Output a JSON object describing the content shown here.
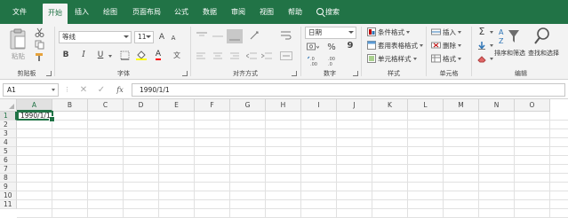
{
  "ribbon": {
    "tabs": [
      {
        "label": "文件",
        "active": false
      },
      {
        "label": "开始",
        "active": true
      },
      {
        "label": "插入",
        "active": false
      },
      {
        "label": "绘图",
        "active": false
      },
      {
        "label": "页面布局",
        "active": false
      },
      {
        "label": "公式",
        "active": false
      },
      {
        "label": "数据",
        "active": false
      },
      {
        "label": "审阅",
        "active": false
      },
      {
        "label": "视图",
        "active": false
      },
      {
        "label": "帮助",
        "active": false
      }
    ],
    "search_label": "搜索",
    "clipboard": {
      "group_label": "剪贴板",
      "paste_label": "粘贴"
    },
    "font": {
      "group_label": "字体",
      "font_name": "等线",
      "font_size": "11",
      "bold": "B",
      "italic": "I",
      "underline": "U",
      "grow": "A",
      "shrink": "A",
      "color_letter": "A",
      "wen": "文"
    },
    "alignment": {
      "group_label": "对齐方式"
    },
    "number": {
      "group_label": "数字",
      "format": "日期",
      "percent": "%",
      "comma": "9"
    },
    "styles": {
      "group_label": "样式",
      "conditional": "条件格式",
      "table_format": "套用表格格式",
      "cell_styles": "单元格样式"
    },
    "cells": {
      "group_label": "单元格",
      "insert": "插入",
      "delete": "删除",
      "format": "格式"
    },
    "editing": {
      "group_label": "编辑",
      "sort_filter": "排序和筛选",
      "find_select": "查找和选择",
      "sum": "Σ"
    }
  },
  "formula_bar": {
    "name_box": "A1",
    "fx": "fx",
    "value": "1990/1/1"
  },
  "sheet": {
    "columns": [
      "A",
      "B",
      "C",
      "D",
      "E",
      "F",
      "G",
      "H",
      "I",
      "J",
      "K",
      "L",
      "M",
      "N",
      "O"
    ],
    "rows": [
      "1",
      "2",
      "3",
      "4",
      "5",
      "6",
      "7",
      "8",
      "9",
      "10",
      "11"
    ],
    "selected_cell": "A1",
    "cells": {
      "A1": "1990/1/1"
    }
  },
  "colors": {
    "accent": "#217346",
    "ribbon_bg": "#f3f3f3"
  }
}
